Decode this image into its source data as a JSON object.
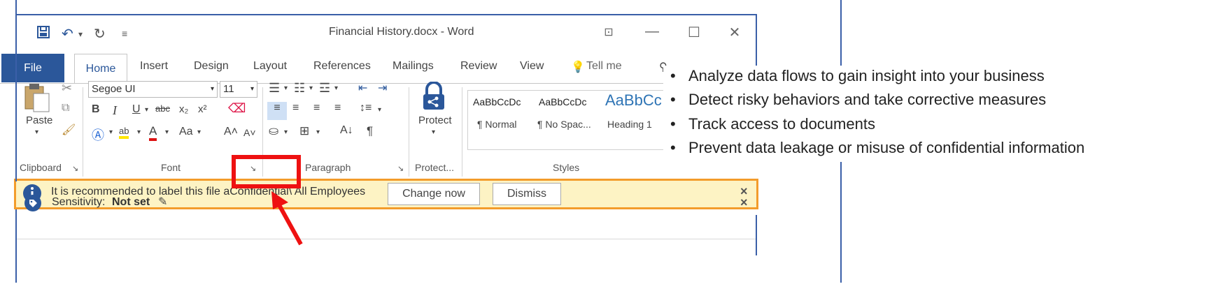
{
  "window": {
    "title": "Financial History.docx - Word",
    "qat": {
      "save_icon": "save-icon",
      "undo_icon": "undo-icon",
      "redo_icon": "redo-icon",
      "customize_icon": "customize-icon"
    },
    "controls": {
      "ribbon_display": "⊡",
      "minimize": "—",
      "maximize": "☐",
      "close": "✕"
    }
  },
  "tabs": {
    "file": "File",
    "home": "Home",
    "insert": "Insert",
    "design": "Design",
    "layout": "Layout",
    "references": "References",
    "mailings": "Mailings",
    "review": "Review",
    "view": "View",
    "tell_me": "Tell me",
    "share": "Sh"
  },
  "ribbon": {
    "clipboard": {
      "paste": "Paste",
      "label": "Clipboard"
    },
    "font": {
      "name": "Segoe UI",
      "size": "11",
      "label": "Font",
      "change_case": "Aa"
    },
    "paragraph": {
      "label": "Paragraph"
    },
    "protect": {
      "button": "Protect",
      "label": "Protect..."
    },
    "styles": {
      "label": "Styles",
      "items": [
        {
          "sample": "AaBbCcDc",
          "name": "¶ Normal"
        },
        {
          "sample": "AaBbCcDc",
          "name": "¶ No Spac..."
        },
        {
          "sample": "AaBbCc",
          "name": "Heading 1"
        }
      ]
    }
  },
  "banner": {
    "message_before": "It is recommended to label this file a",
    "label": "Confidential",
    "message_after": "\\ All Employees",
    "change_button": "Change now",
    "dismiss_button": "Dismiss",
    "close": "×"
  },
  "sensitivity": {
    "label": "Sensitivity:",
    "value": "Not set",
    "close": "×"
  },
  "bullets": [
    "Analyze data flows to gain insight into your business",
    "Detect risky behaviors and take corrective measures",
    "Track access to documents",
    "Prevent data leakage or misuse of confidential information"
  ],
  "colors": {
    "accent": "#2b579a",
    "banner_bg": "#fdf3c4",
    "banner_border": "#f39c2b",
    "highlight": "#ee1111"
  }
}
